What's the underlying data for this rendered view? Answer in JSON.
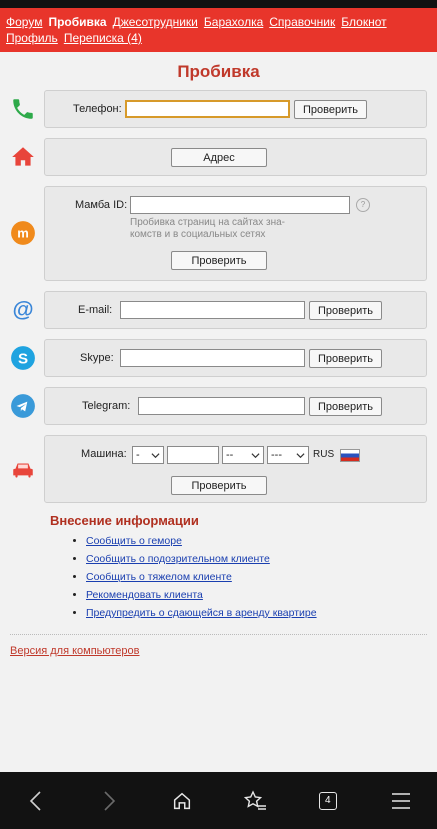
{
  "nav": {
    "row1": [
      "Форум",
      "Пробивка",
      "Джесотрудники",
      "Барахолка",
      "Справочник",
      "Блокнот"
    ],
    "row2": [
      "Профиль",
      "Переписка (4)"
    ],
    "active": "Пробивка"
  },
  "page_title": "Пробивка",
  "phone": {
    "label": "Телефон:",
    "value": "",
    "button": "Проверить"
  },
  "address": {
    "button": "Адрес"
  },
  "mamba": {
    "label": "Мамба ID:",
    "value": "",
    "hint_line1": "Пробивка страниц на сайтах зна-",
    "hint_line2": "комств и в социальных сетях",
    "help": "?",
    "button": "Проверить"
  },
  "email": {
    "label": "E-mail:",
    "value": "",
    "button": "Проверить"
  },
  "skype": {
    "label": "Skype:",
    "value": "",
    "button": "Проверить"
  },
  "telegram": {
    "label": "Telegram:",
    "value": "",
    "button": "Проверить"
  },
  "car": {
    "label": "Машина:",
    "sel1": "-",
    "sel2": "--",
    "sel3": "---",
    "region": "RUS",
    "button": "Проверить"
  },
  "info": {
    "title": "Внесение информации",
    "links": [
      "Сообщить о геморе",
      "Сообщить о подозрительном клиенте",
      "Сообщить о тяжелом клиенте",
      "Рекомендовать клиента",
      "Предупредить о сдающейся в аренду квартире"
    ]
  },
  "desktop_link": "Версия для компьютеров",
  "bottom_nav": {
    "tabs_count": "4"
  },
  "colors": {
    "accent": "#e8352b",
    "title": "#c0392b",
    "link": "#1a3fb0"
  }
}
